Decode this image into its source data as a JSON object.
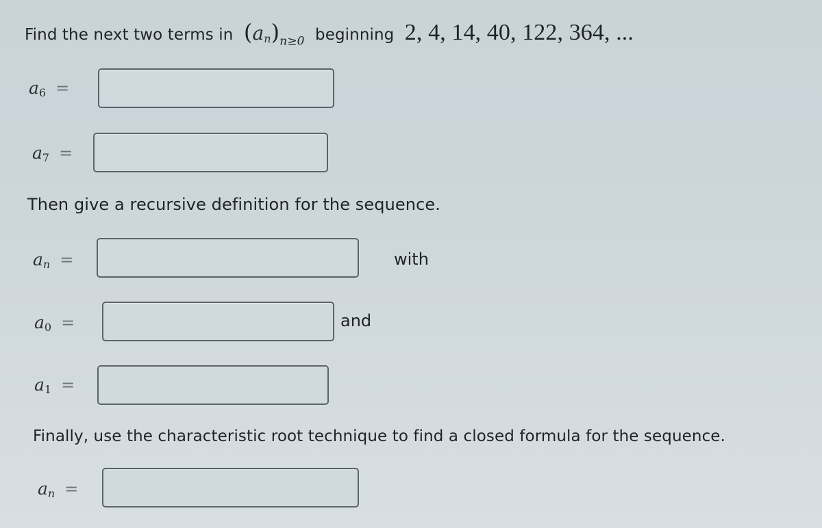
{
  "question": {
    "intro_text": "Find the next two terms in",
    "sequence_symbol": "a",
    "sequence_index": "n",
    "index_condition": "n≥0",
    "beginning_label": "beginning",
    "sequence_terms": "2, 4, 14, 40, 122, 364, ..."
  },
  "next_terms": [
    {
      "symbol": "a",
      "subscript": "6",
      "equals": "=",
      "value": ""
    },
    {
      "symbol": "a",
      "subscript": "7",
      "equals": "=",
      "value": ""
    }
  ],
  "recursive_section": {
    "instruction": "Then give a recursive definition for the sequence.",
    "recurrence": {
      "symbol": "a",
      "subscript": "n",
      "equals": "=",
      "value": "",
      "suffix": "with"
    },
    "initial_a0": {
      "symbol": "a",
      "subscript": "0",
      "equals": "=",
      "value": "",
      "suffix": "and"
    },
    "initial_a1": {
      "symbol": "a",
      "subscript": "1",
      "equals": "=",
      "value": ""
    }
  },
  "closed_formula_section": {
    "instruction": "Finally, use the characteristic root technique to find a closed formula for the sequence.",
    "formula": {
      "symbol": "a",
      "subscript": "n",
      "equals": "=",
      "value": ""
    }
  }
}
